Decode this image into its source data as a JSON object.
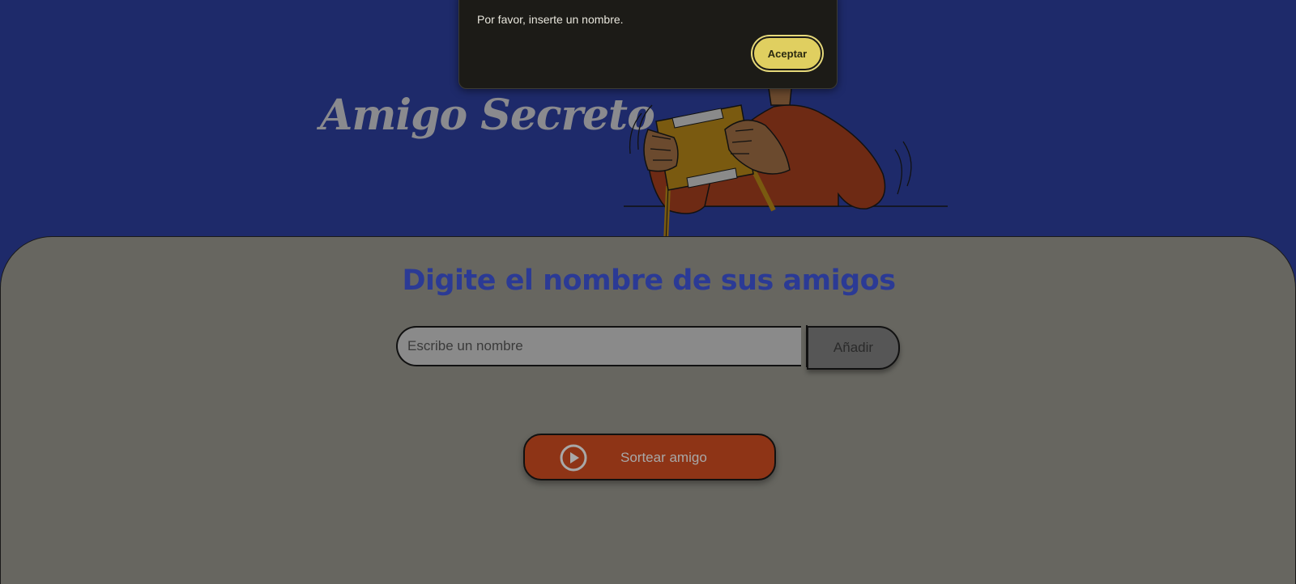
{
  "header": {
    "title": "Amigo Secreto"
  },
  "main": {
    "heading": "Digite el nombre de sus amigos",
    "input": {
      "placeholder": "Escribe un nombre",
      "value": ""
    },
    "add_label": "Añadir",
    "draw_label": "Sortear amigo"
  },
  "dialog": {
    "message": "Por favor, inserte un nombre.",
    "accept_label": "Aceptar"
  },
  "colors": {
    "background": "#1e2a6a",
    "card": "#676660",
    "heading": "#2b3a95",
    "draw_button": "#8e3416",
    "accept_button": "#e0cf60",
    "dialog": "#1c1b17"
  },
  "icons": {
    "draw": "play-circle-icon"
  }
}
